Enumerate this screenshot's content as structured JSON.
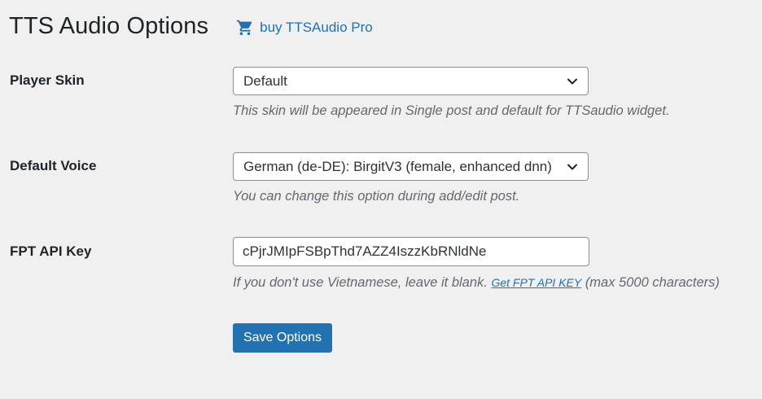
{
  "header": {
    "title": "TTS Audio Options",
    "buy_link_label": "buy TTSAudio Pro",
    "buy_icon": "cart-icon"
  },
  "fields": {
    "player_skin": {
      "label": "Player Skin",
      "value": "Default",
      "description": "This skin will be appeared in Single post and default for TTSaudio widget."
    },
    "default_voice": {
      "label": "Default Voice",
      "value": "German (de-DE): BirgitV3 (female, enhanced dnn)",
      "description": "You can change this option during add/edit post."
    },
    "fpt_api_key": {
      "label": "FPT API Key",
      "value": "cPjrJMIpFSBpThd7AZZ4IszzKbRNldNe",
      "description_before": "If you don't use Vietnamese, leave it blank.",
      "description_link": "Get FPT API KEY",
      "description_after": "(max 5000 characters)"
    }
  },
  "actions": {
    "save_label": "Save Options"
  },
  "colors": {
    "accent": "#2271b1",
    "background": "#f0f0f1",
    "text": "#1d2327",
    "muted": "#646970"
  }
}
